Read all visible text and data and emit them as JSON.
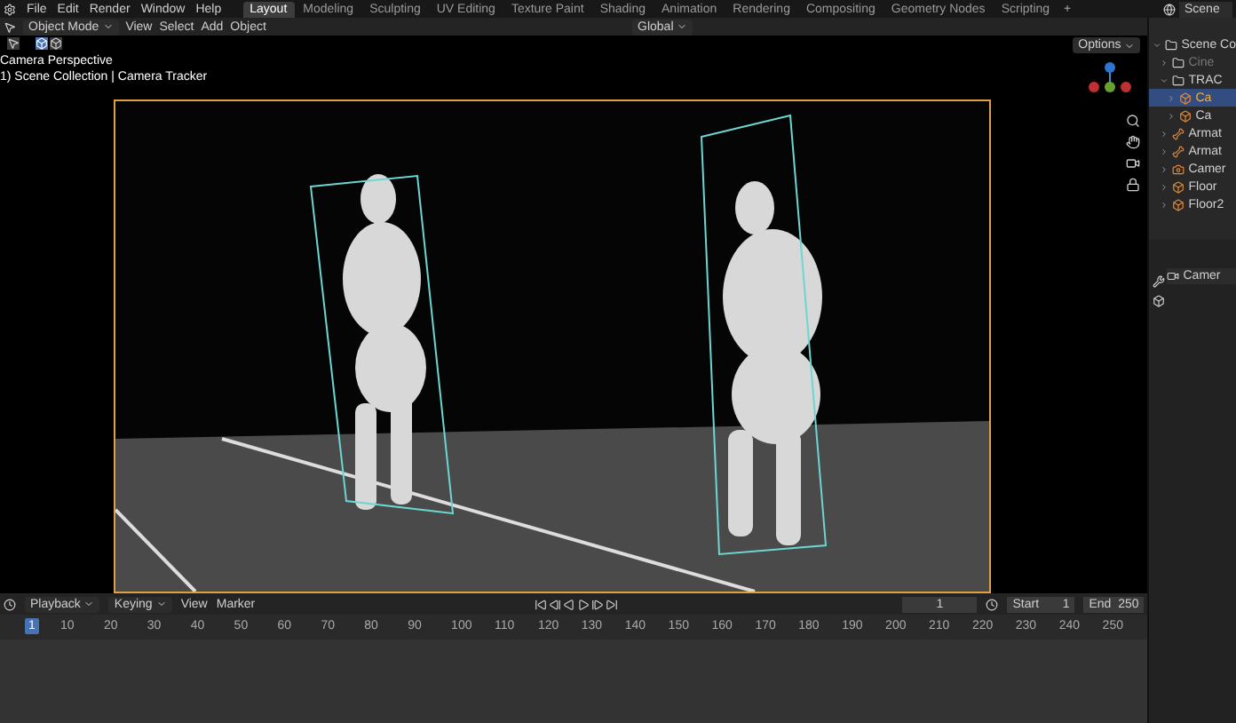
{
  "menu": [
    "File",
    "Edit",
    "Render",
    "Window",
    "Help"
  ],
  "workspaces": [
    {
      "label": "Layout",
      "selected": true
    },
    {
      "label": "Modeling",
      "selected": false
    },
    {
      "label": "Sculpting",
      "selected": false
    },
    {
      "label": "UV Editing",
      "selected": false
    },
    {
      "label": "Texture Paint",
      "selected": false
    },
    {
      "label": "Shading",
      "selected": false
    },
    {
      "label": "Animation",
      "selected": false
    },
    {
      "label": "Rendering",
      "selected": false
    },
    {
      "label": "Compositing",
      "selected": false
    },
    {
      "label": "Geometry Nodes",
      "selected": false
    },
    {
      "label": "Scripting",
      "selected": false
    }
  ],
  "add_workspace": "+",
  "scene": "Scene",
  "header": {
    "mode": "Object Mode",
    "menus": [
      "View",
      "Select",
      "Add",
      "Object"
    ],
    "orientation": "Global"
  },
  "viewport": {
    "options": "Options",
    "title": "Camera Perspective",
    "subtitle": "1) Scene Collection | Camera Tracker"
  },
  "outliner": {
    "items": [
      {
        "label": "Scene Co",
        "kind": "collection",
        "selected": false,
        "disabled": false,
        "children": [
          {
            "label": "Cine",
            "kind": "collection",
            "selected": false,
            "disabled": true
          },
          {
            "label": "TRAC",
            "kind": "collection",
            "selected": false,
            "disabled": false,
            "children": [
              {
                "label": "Ca",
                "kind": "mesh",
                "selected": true,
                "disabled": false
              },
              {
                "label": "Ca",
                "kind": "mesh",
                "selected": false,
                "disabled": false
              }
            ]
          },
          {
            "label": "Armat",
            "kind": "armature",
            "selected": false,
            "disabled": false
          },
          {
            "label": "Armat",
            "kind": "armature",
            "selected": false,
            "disabled": false
          },
          {
            "label": "Camer",
            "kind": "camera",
            "selected": false,
            "disabled": false
          },
          {
            "label": "Floor",
            "kind": "mesh",
            "selected": false,
            "disabled": false
          },
          {
            "label": "Floor2",
            "kind": "mesh",
            "selected": false,
            "disabled": false
          }
        ]
      }
    ]
  },
  "properties": {
    "object": "Camer"
  },
  "timeline": {
    "menus": [
      "Playback",
      "Keying",
      "View",
      "Marker"
    ],
    "current_frame": "1",
    "start_label": "Start",
    "start": "1",
    "end_label": "End",
    "end": "250",
    "ticks": [
      "1",
      "10",
      "20",
      "30",
      "40",
      "50",
      "60",
      "70",
      "80",
      "90",
      "100",
      "110",
      "120",
      "130",
      "140",
      "150",
      "160",
      "170",
      "180",
      "190",
      "200",
      "210",
      "220",
      "230",
      "240",
      "250"
    ]
  }
}
